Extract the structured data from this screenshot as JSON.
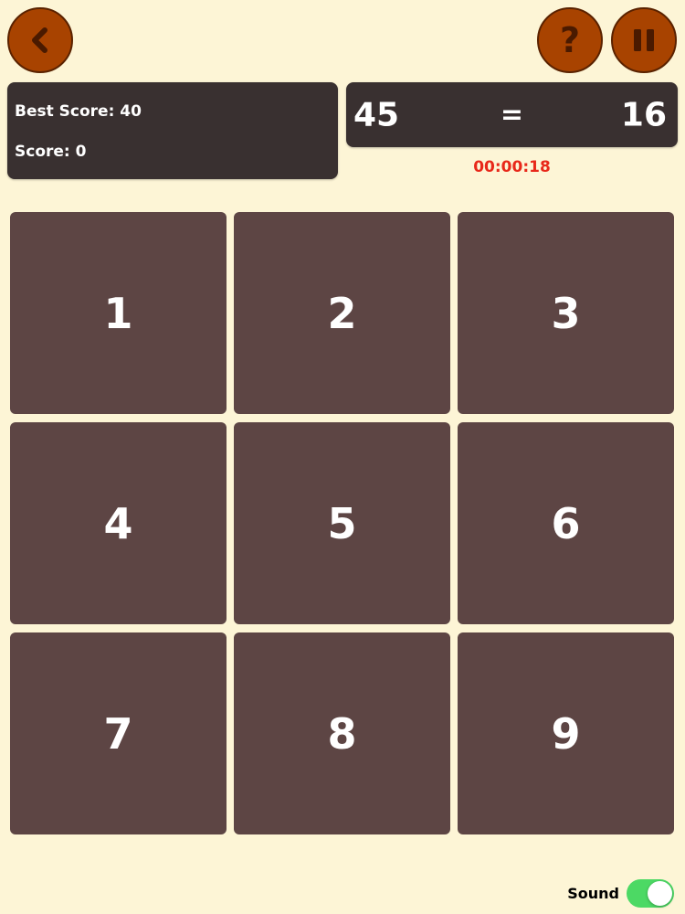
{
  "header": {
    "back_button_icon": "chevron-left-icon",
    "help_button_icon": "question-mark-icon",
    "help_glyph": "?",
    "pause_button_icon": "pause-icon"
  },
  "scoreboard": {
    "best_score_text": "Best Score: 40",
    "score_text": "Score: 0"
  },
  "equation": {
    "left": "45",
    "operator": "=",
    "right": "16"
  },
  "timer": "00:00:18",
  "keypad": [
    "1",
    "2",
    "3",
    "4",
    "5",
    "6",
    "7",
    "8",
    "9"
  ],
  "sound": {
    "label": "Sound",
    "enabled": true
  },
  "colors": {
    "background": "#fdf5d6",
    "button_fill": "#a84300",
    "button_icon": "#4a1a00",
    "panel": "#393030",
    "tile": "#5d4544",
    "timer": "#e8281a",
    "toggle_on": "#4cd964"
  }
}
